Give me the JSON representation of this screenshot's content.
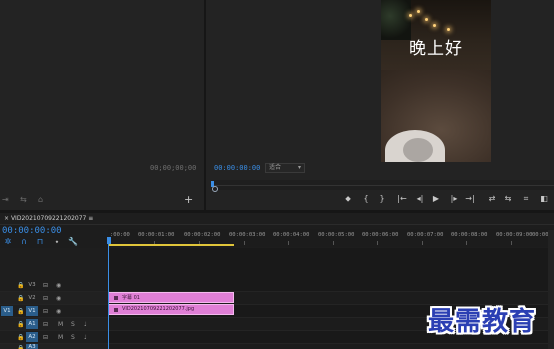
{
  "source_monitor": {
    "timecode": "00;00;00;00",
    "controls": [
      "⇥",
      "⇆",
      "⌂"
    ],
    "add_label": "+"
  },
  "program_monitor": {
    "overlay_text": "晚上好",
    "timecode": "00:00:00:00",
    "fit_dropdown": "适合",
    "playback_progress": 0,
    "controls": [
      "⬥",
      "{",
      "}",
      "|←",
      "◂|",
      "▶",
      "|▸",
      "→|",
      "⇄",
      "⇆",
      "⌗",
      "◧"
    ]
  },
  "timeline": {
    "tab_title": "VID20210709221202077",
    "timecode": "00:00:00:00",
    "ruler_labels": [
      ":00:00",
      "00:00:01:00",
      "00:00:02:00",
      "00:00:03:00",
      "00:00:04:00",
      "00:00:05:00",
      "00:00:06:00",
      "00:00:07:00",
      "00:00:08:00",
      "00:00:09:00",
      "00:00"
    ],
    "tools": [
      "✲",
      "∩",
      "⊓",
      "⬩",
      "🔧"
    ],
    "tracks": [
      {
        "name": "V3",
        "source": "",
        "lock": "🔒"
      },
      {
        "name": "V2",
        "source": "",
        "lock": "🔒"
      },
      {
        "name": "V1",
        "source": "V1",
        "lock": "🔒"
      },
      {
        "name": "A1",
        "source": "",
        "lock": "🔒",
        "m": "M",
        "s": "S"
      },
      {
        "name": "A2",
        "source": "",
        "lock": "🔒",
        "m": "M",
        "s": "S"
      },
      {
        "name": "A3",
        "source": "",
        "lock": "🔒",
        "m": "M",
        "s": "S"
      }
    ],
    "clips": [
      {
        "label": "字幕 01",
        "track": "V2"
      },
      {
        "label": "VID20210709221202077.jpg",
        "track": "V1"
      }
    ]
  },
  "watermark": "最需教育",
  "colors": {
    "accent": "#3a8ee6",
    "clip": "#e07fd6",
    "work_area": "#e0c53a"
  }
}
